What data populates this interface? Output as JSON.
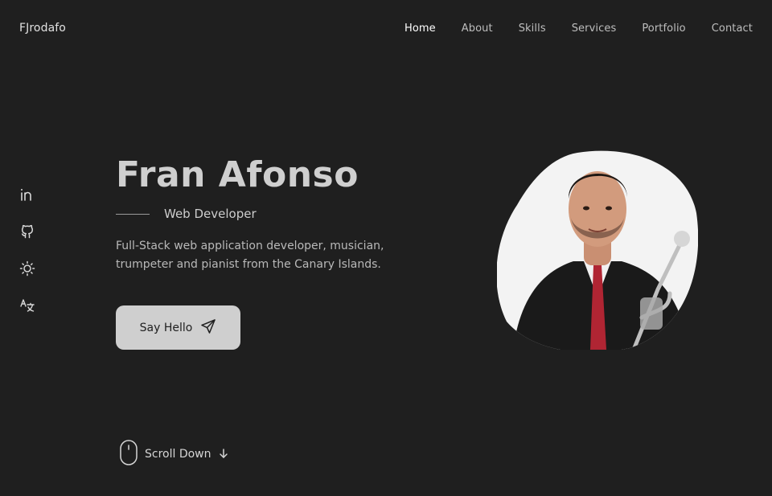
{
  "header": {
    "logo": "FJrodafo",
    "nav": [
      {
        "label": "Home",
        "active": true
      },
      {
        "label": "About",
        "active": false
      },
      {
        "label": "Skills",
        "active": false
      },
      {
        "label": "Services",
        "active": false
      },
      {
        "label": "Portfolio",
        "active": false
      },
      {
        "label": "Contact",
        "active": false
      }
    ]
  },
  "sidebar": {
    "icons": [
      "linkedin-icon",
      "github-icon",
      "sun-icon",
      "translate-icon"
    ]
  },
  "hero": {
    "name": "Fran Afonso",
    "role": "Web Developer",
    "description": "Full-Stack web application developer, musician, trumpeter and pianist from the Canary Islands.",
    "cta_label": "Say Hello",
    "cta_icon": "send-icon"
  },
  "scroll": {
    "label": "Scroll Down",
    "icons": [
      "mouse-icon",
      "arrow-down-icon"
    ]
  },
  "portrait": {
    "icon": "profile-photo"
  },
  "colors": {
    "background": "#1f1f1f",
    "title": "#cfcfcf",
    "button_bg": "#cfcfcf",
    "button_text": "#1f1f1f"
  }
}
